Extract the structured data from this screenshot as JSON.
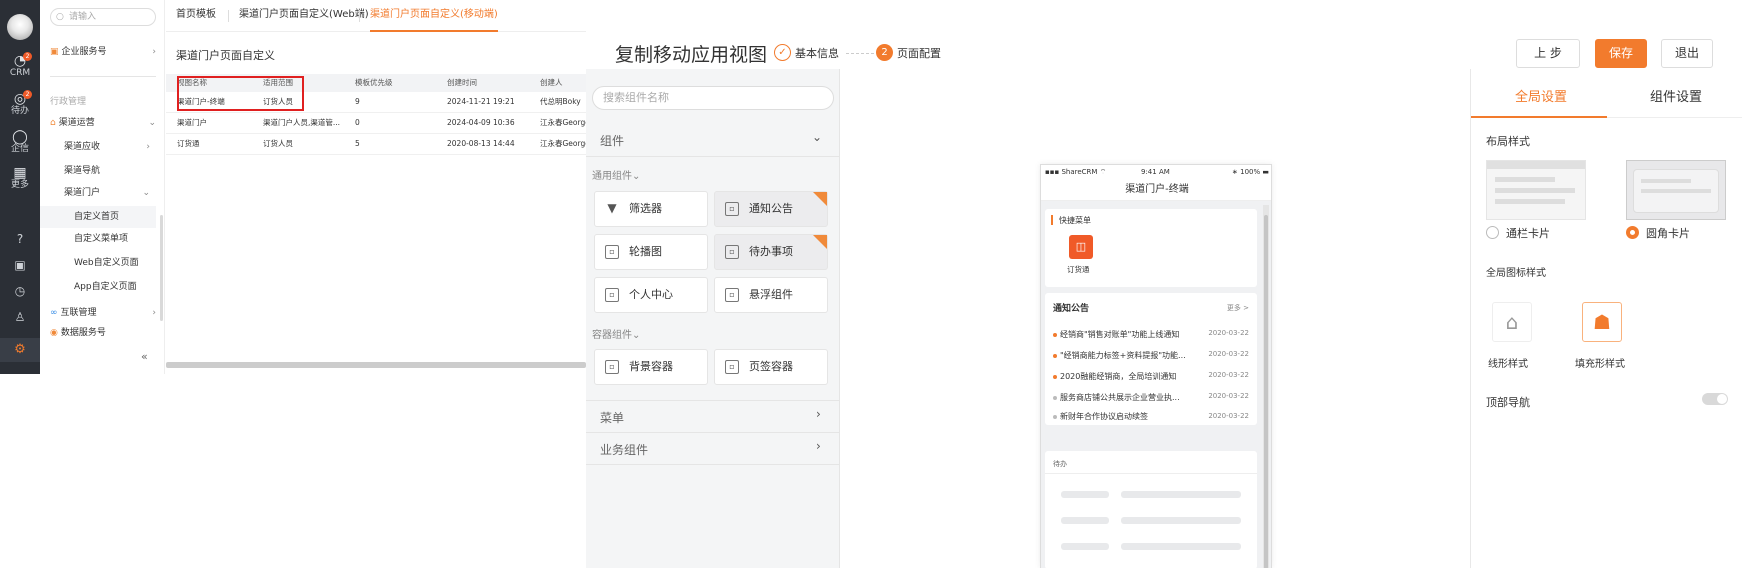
{
  "rail": {
    "crm": "CRM",
    "todo": "待办",
    "badge_crm": "2",
    "badge_todo": "2",
    "chat": "企信",
    "more": "更多"
  },
  "nav": {
    "search_placeholder": "请输入",
    "items": [
      "企业服务号",
      "行政管理",
      "渠道运营",
      "渠道应收",
      "渠道导航",
      "渠道门户",
      "自定义首页",
      "自定义菜单项",
      "Web自定义页面",
      "App自定义页面",
      "互联管理",
      "数据服务号"
    ],
    "collapse": "«"
  },
  "tabs": [
    "首页模板",
    "渠道门户页面自定义(Web端)",
    "渠道门户页面自定义(移动端)"
  ],
  "table": {
    "title": "渠道门户页面自定义",
    "headers": [
      "视图名称",
      "适用范围",
      "模板优先级",
      "创建时间",
      "创建人"
    ],
    "rows": [
      [
        "渠道门户-终端",
        "订货人员",
        "9",
        "2024-11-21 19:21",
        "代总明Boky"
      ],
      [
        "渠道门户",
        "渠道门户人员,渠道管...",
        "0",
        "2024-04-09 10:36",
        "江永春George"
      ],
      [
        "订货通",
        "订货人员",
        "5",
        "2020-08-13 14:44",
        "江永春George"
      ]
    ]
  },
  "header": {
    "title": "复制移动应用视图",
    "step1": "基本信息",
    "step2_num": "2",
    "step2": "页面配置",
    "btn_prev": "上 步",
    "btn_save": "保存",
    "btn_exit": "退出"
  },
  "components": {
    "search_placeholder": "搜索组件名称",
    "section": "组件",
    "group1": "通用组件",
    "group1_items": [
      "筛选器",
      "通知公告",
      "轮播图",
      "待办事项",
      "个人中心",
      "悬浮组件"
    ],
    "group2": "容器组件",
    "group2_items": [
      "背景容器",
      "页签容器"
    ],
    "menu": "菜单",
    "biz": "业务组件"
  },
  "phone": {
    "status_left": "ShareCRM",
    "status_time": "9:41 AM",
    "status_right": "100%",
    "title": "渠道门户-终端",
    "quick_title": "快捷菜单",
    "quick_item": "订货通",
    "notice_title": "通知公告",
    "notice_more": "更多 >",
    "notices": [
      {
        "text": "经销商\"销售对账单\"功能上线通知",
        "date": "2020-03-22"
      },
      {
        "text": "\"经销商能力标签+资料提报\"功能...",
        "date": "2020-03-22"
      },
      {
        "text": "2020融能经销商，全局培训通知",
        "date": "2020-03-22"
      },
      {
        "text": "服务商店铺公共展示企业营业执...",
        "date": "2020-03-22"
      },
      {
        "text": "新财年合作协议启动续签",
        "date": "2020-03-22"
      }
    ],
    "todo_title": "待办"
  },
  "settings": {
    "tab_global": "全局设置",
    "tab_component": "组件设置",
    "layout_label": "布局样式",
    "layout_opt1": "通栏卡片",
    "layout_opt2": "圆角卡片",
    "icon_label": "全局图标样式",
    "icon_opt1": "线形样式",
    "icon_opt2": "填充形样式",
    "topnav_label": "顶部导航"
  },
  "colors": {
    "accent": "#f27b2d",
    "rail": "#2b2f36",
    "highlight": "#e02020"
  }
}
